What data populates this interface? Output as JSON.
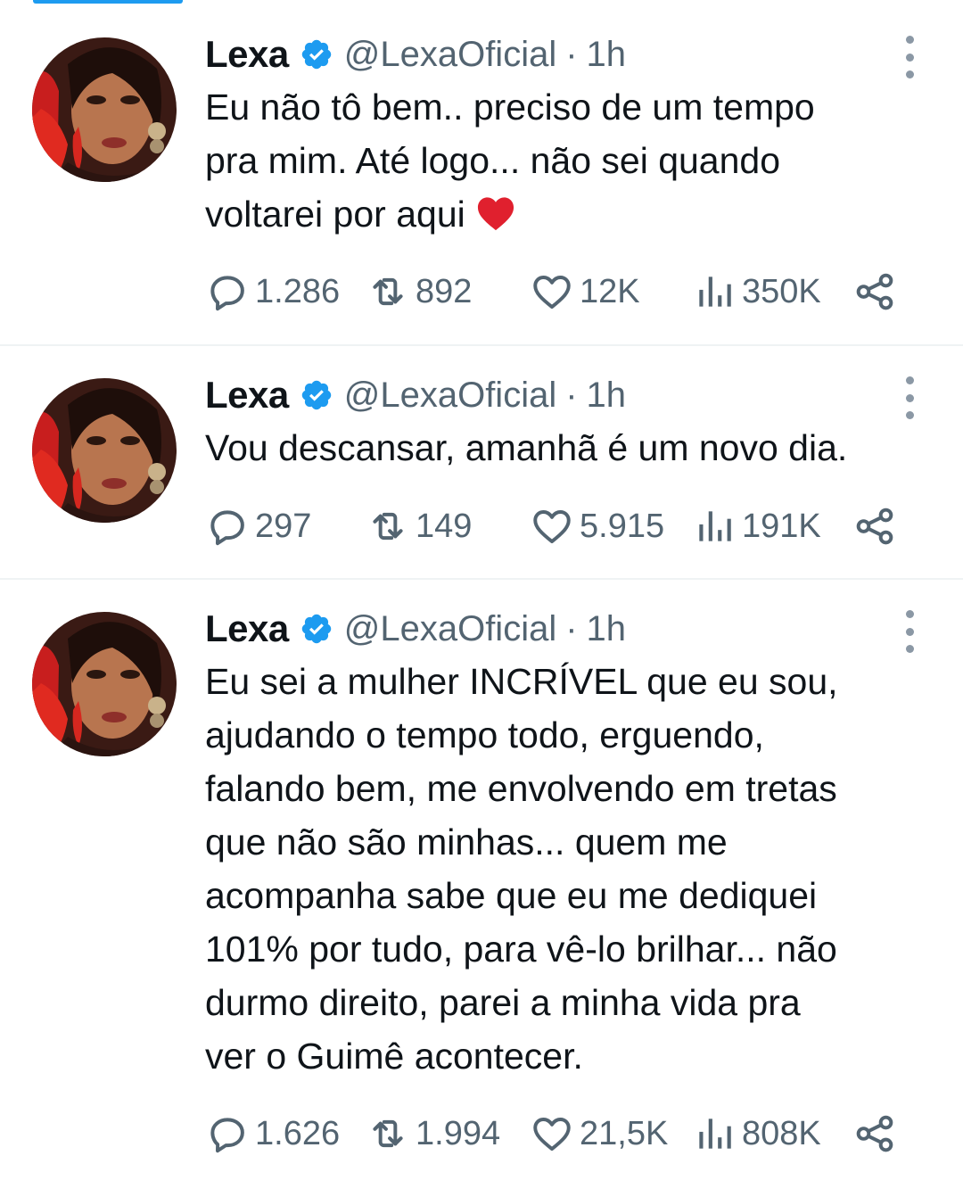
{
  "tweets": [
    {
      "name": "Lexa",
      "handle": "@LexaOficial",
      "separator": "·",
      "time": "1h",
      "text": "Eu não tô bem.. preciso de um tempo\npra mim. Até logo... não sei quando\nvoltarei por aqui",
      "emoji": "heart-emoji",
      "replies": "1.286",
      "retweets": "892",
      "likes": "12K",
      "views": "350K"
    },
    {
      "name": "Lexa",
      "handle": "@LexaOficial",
      "separator": "·",
      "time": "1h",
      "text": "Vou descansar, amanhã é um novo dia.",
      "replies": "297",
      "retweets": "149",
      "likes": "5.915",
      "views": "191K"
    },
    {
      "name": "Lexa",
      "handle": "@LexaOficial",
      "separator": "·",
      "time": "1h",
      "text": "Eu sei a mulher INCRÍVEL que eu sou,\najudando o tempo todo, erguendo,\nfalando bem, me envolvendo em tretas\nque não são minhas... quem me\nacompanha sabe que eu me dediquei\n101% por tudo, para vê-lo brilhar... não\ndurmo direito, parei a minha vida pra\nver o Guimê acontecer.",
      "replies": "1.626",
      "retweets": "1.994",
      "likes": "21,5K",
      "views": "808K"
    }
  ],
  "colors": {
    "accent": "#1d9bf0",
    "text": "#0f1419",
    "secondary": "#536471",
    "divider": "#eff3f4"
  },
  "icons": [
    "verified-badge-icon",
    "more-icon",
    "reply-icon",
    "retweet-icon",
    "like-icon",
    "views-icon",
    "share-icon",
    "heart-emoji"
  ]
}
